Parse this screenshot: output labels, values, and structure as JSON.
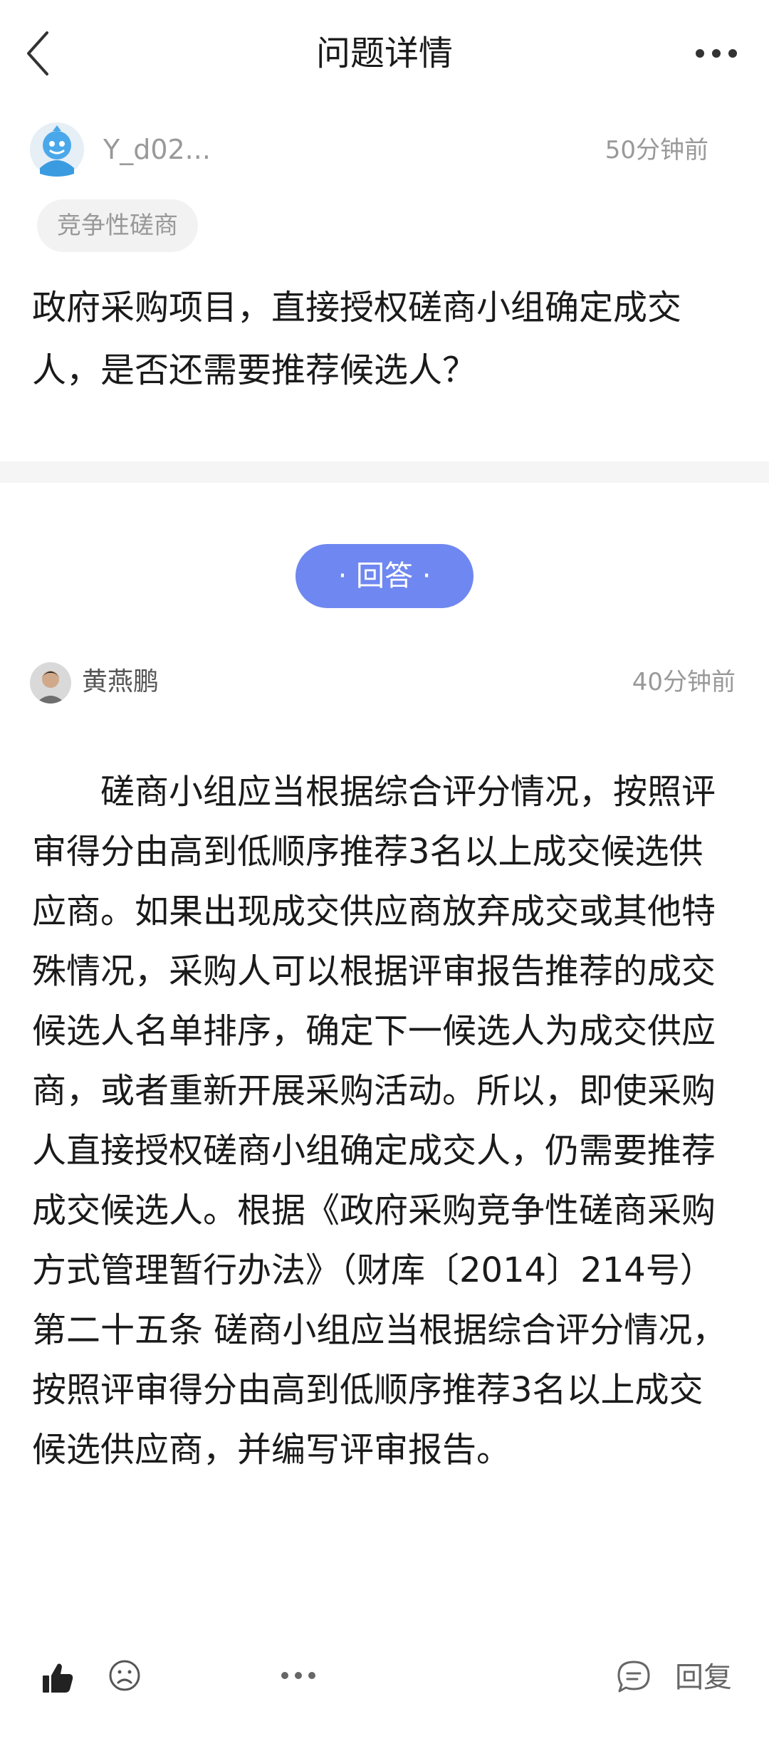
{
  "header": {
    "title": "问题详情",
    "back_icon": "chevron-left-icon",
    "more_icon": "more-horizontal-icon"
  },
  "question": {
    "asker_name": "Y_d02...",
    "time": "50分钟前",
    "tag": "竞争性磋商",
    "text": "政府采购项目，直接授权磋商小组确定成交人，是否还需要推荐候选人？"
  },
  "answer_button": {
    "label": "· 回答 ·"
  },
  "answer": {
    "answerer_name": "黄燕鹏",
    "time": "40分钟前",
    "text": "磋商小组应当根据综合评分情况，按照评审得分由高到低顺序推荐3名以上成交候选供应商。如果出现成交供应商放弃成交或其他特殊情况，采购人可以根据评审报告推荐的成交候选人名单排序，确定下一候选人为成交供应商，或者重新开展采购活动。所以，即使采购人直接授权磋商小组确定成交人，仍需要推荐成交候选人。根据《政府采购竞争性磋商采购方式管理暂行办法》（财库〔2014〕214号）第二十五条 磋商小组应当根据综合评分情况，按照评审得分由高到低顺序推荐3名以上成交候选供应商，并编写评审报告。"
  },
  "footer": {
    "like_icon": "thumbs-up-icon",
    "dislike_icon": "sad-face-icon",
    "more_icon": "more-horizontal-icon",
    "reply_icon": "comment-icon",
    "reply_label": "回复"
  },
  "colors": {
    "accent": "#6f87f0",
    "muted_text": "#999999",
    "tag_background": "#f2f2f2"
  }
}
